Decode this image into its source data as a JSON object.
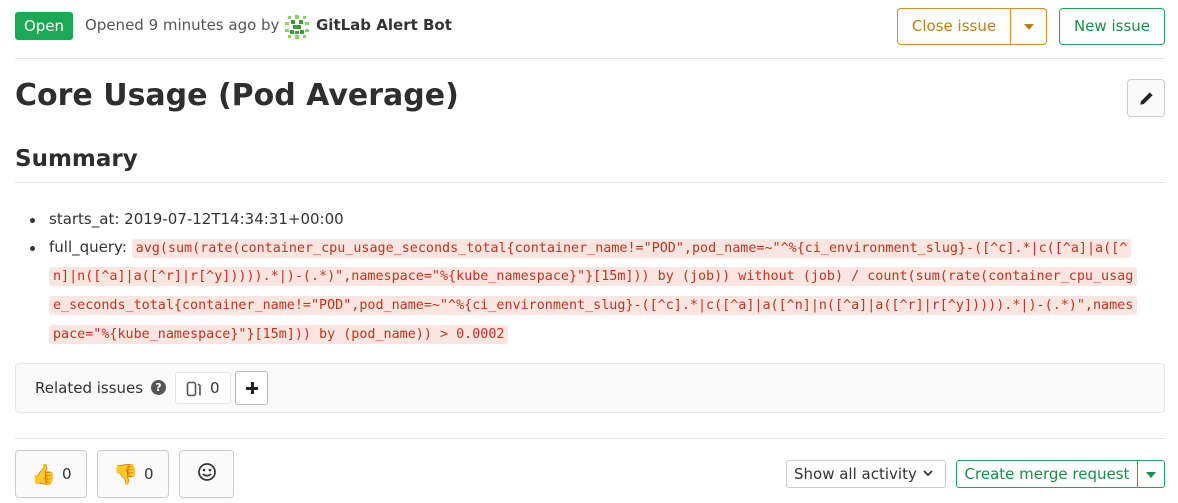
{
  "header": {
    "status": "Open",
    "opened_text": "Opened 9 minutes ago by",
    "author": "GitLab Alert Bot",
    "author_avatar_icon": "gitlab-bot-avatar-icon",
    "close_button": "Close issue",
    "new_button": "New issue"
  },
  "issue": {
    "title": "Core Usage (Pod Average)",
    "edit_icon": "pencil-icon"
  },
  "description": {
    "heading": "Summary",
    "items": [
      {
        "key": "starts_at:",
        "value": "2019-07-12T14:34:31+00:00"
      },
      {
        "key": "full_query:",
        "code": "avg(sum(rate(container_cpu_usage_seconds_total{container_name!=\"POD\",pod_name=~\"^%{ci_environment_slug}-([^c].*|c([^a]|a([^n]|n([^a]|a([^r]|r[^y])))).*|)-(.*)\",namespace=\"%{kube_namespace}\"}[15m])) by (job)) without (job) / count(sum(rate(container_cpu_usage_seconds_total{container_name!=\"POD\",pod_name=~\"^%{ci_environment_slug}-([^c].*|c([^a]|a([^n]|n([^a]|a([^r]|r[^y])))).*|)-(.*)\",namespace=\"%{kube_namespace}\"}[15m])) by (pod_name)) > 0.0002"
      }
    ]
  },
  "related_issues": {
    "label": "Related issues",
    "help_icon": "question-circle-icon",
    "count": "0",
    "issues_icon": "issues-icon",
    "add_icon": "plus-icon"
  },
  "awards": {
    "thumbs_up": {
      "emoji": "👍",
      "count": "0"
    },
    "thumbs_down": {
      "emoji": "👎",
      "count": "0"
    },
    "smile_icon": "slightly-smiling-face-icon"
  },
  "footer": {
    "activity_filter": "Show all activity",
    "create_mr_button": "Create merge request"
  },
  "colors": {
    "open_badge": "#1aaa55",
    "close_button": "#db8d2e",
    "new_button": "#1aaa55",
    "code_text": "#c0341d",
    "code_bg": "#fbe5e1"
  }
}
